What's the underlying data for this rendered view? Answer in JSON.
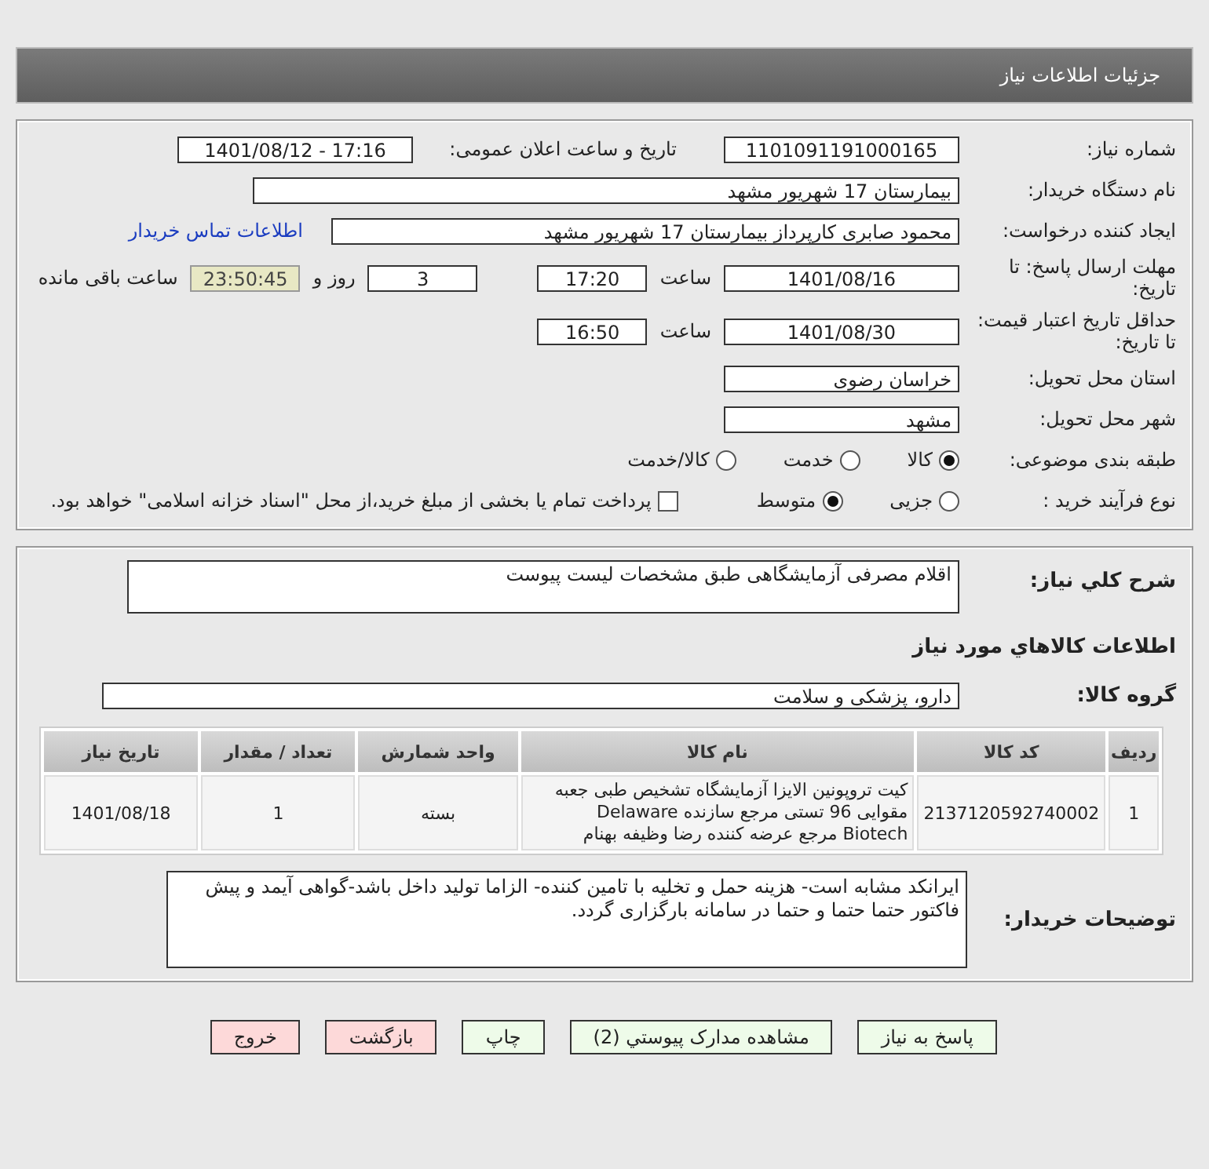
{
  "header": {
    "title": "جزئیات اطلاعات نیاز"
  },
  "need_number": {
    "label": "شماره نیاز:",
    "value": "1101091191000165"
  },
  "announce": {
    "label": "تاریخ و ساعت اعلان عمومی:",
    "value": "1401/08/12 - 17:16"
  },
  "buyer_org": {
    "label": "نام دستگاه خریدار:",
    "value": "بیمارستان 17 شهریور مشهد"
  },
  "requester": {
    "label": "ایجاد کننده درخواست:",
    "value": "محمود صابری کارپرداز بیمارستان 17 شهریور مشهد",
    "link": "اطلاعات تماس خریدار"
  },
  "deadline": {
    "label": "مهلت ارسال پاسخ: تا تاریخ:",
    "date": "1401/08/16",
    "time_label": "ساعت",
    "time": "17:20",
    "days": "3",
    "days_label": "روز و",
    "remaining": "23:50:45",
    "remaining_label": "ساعت باقی مانده"
  },
  "validity": {
    "label": "حداقل تاریخ اعتبار قیمت: تا تاریخ:",
    "date": "1401/08/30",
    "time_label": "ساعت",
    "time": "16:50"
  },
  "province": {
    "label": "استان محل تحویل:",
    "value": "خراسان رضوی"
  },
  "city": {
    "label": "شهر محل تحویل:",
    "value": "مشهد"
  },
  "category": {
    "label": "طبقه بندی موضوعی:",
    "options": [
      {
        "label": "کالا",
        "selected": true
      },
      {
        "label": "خدمت",
        "selected": false
      },
      {
        "label": "کالا/خدمت",
        "selected": false
      }
    ]
  },
  "process": {
    "label": "نوع فرآیند خرید :",
    "options": [
      {
        "label": "جزیی",
        "selected": false
      },
      {
        "label": "متوسط",
        "selected": true
      }
    ],
    "checkbox": {
      "label": "پرداخت تمام یا بخشی از مبلغ خرید،از محل \"اسناد خزانه اسلامی\" خواهد بود.",
      "checked": false
    }
  },
  "description": {
    "label": "شرح كلي نياز:",
    "value": "اقلام مصرفی آزمایشگاهی طبق مشخصات لیست پیوست"
  },
  "items_title": "اطلاعات كالاهاي مورد نياز",
  "group": {
    "label": "گروه كالا:",
    "value": "دارو، پزشکی و سلامت"
  },
  "table": {
    "columns": [
      "ردیف",
      "کد کالا",
      "نام کالا",
      "واحد شمارش",
      "تعداد / مقدار",
      "تاریخ نیاز"
    ],
    "rows": [
      [
        "1",
        "2137120592740002",
        "کیت تروپونین الایزا آزمایشگاه تشخیص طبی جعبه مقوایی 96 تستی مرجع سازنده Delaware Biotech مرجع عرضه کننده رضا وظیفه بهنام",
        "بسته",
        "1",
        "1401/08/18"
      ]
    ]
  },
  "notes": {
    "label": "توضیحات خریدار:",
    "value": "ایرانکد مشابه است- هزینه حمل و تخلیه با تامین کننده- الزاما تولید داخل باشد-گواهی آیمد و پیش فاکتور حتما حتما و حتما در سامانه بارگزاری گردد."
  },
  "buttons": [
    {
      "label": "پاسخ به نیاز",
      "kind": "action"
    },
    {
      "label": "مشاهده مدارک پیوستي (2)",
      "kind": "action"
    },
    {
      "label": "چاپ",
      "kind": "action"
    },
    {
      "label": "بازگشت",
      "kind": "exit"
    },
    {
      "label": "خروج",
      "kind": "exit"
    }
  ]
}
